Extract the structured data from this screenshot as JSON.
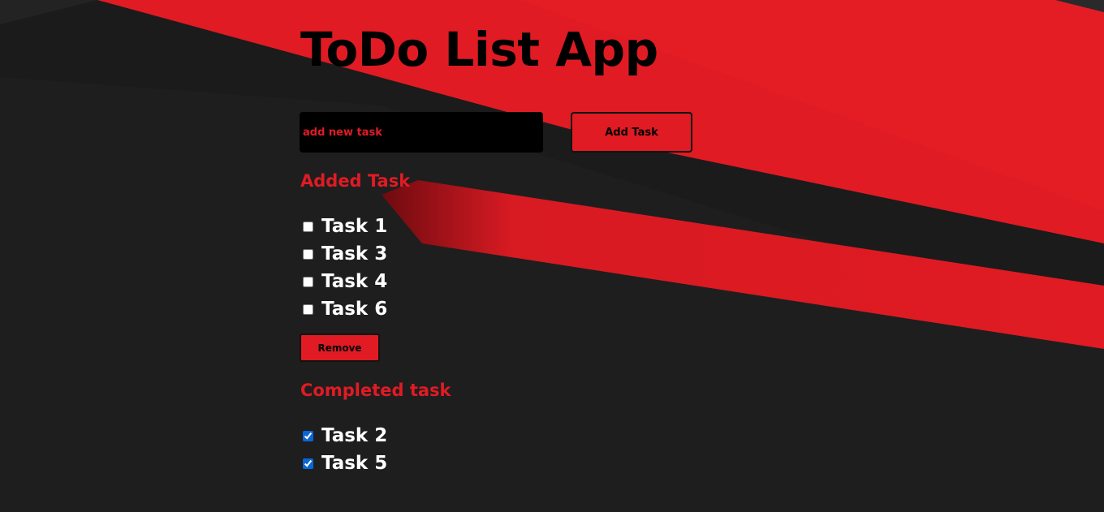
{
  "app": {
    "title": "ToDo List App"
  },
  "input": {
    "placeholder": "add new task",
    "value": ""
  },
  "buttons": {
    "add_label": "Add Task",
    "remove_label": "Remove"
  },
  "added": {
    "heading": "Added Task",
    "items": [
      {
        "label": "Task 1",
        "checked": false
      },
      {
        "label": "Task 3",
        "checked": false
      },
      {
        "label": "Task 4",
        "checked": false
      },
      {
        "label": "Task 6",
        "checked": false
      }
    ]
  },
  "completed": {
    "heading": "Completed task",
    "items": [
      {
        "label": "Task 2",
        "checked": true
      },
      {
        "label": "Task 5",
        "checked": true
      }
    ]
  },
  "colors": {
    "accent_red": "#e01b23",
    "background_dark": "#1b1b1c",
    "checkbox_blue": "#0a66d8"
  }
}
